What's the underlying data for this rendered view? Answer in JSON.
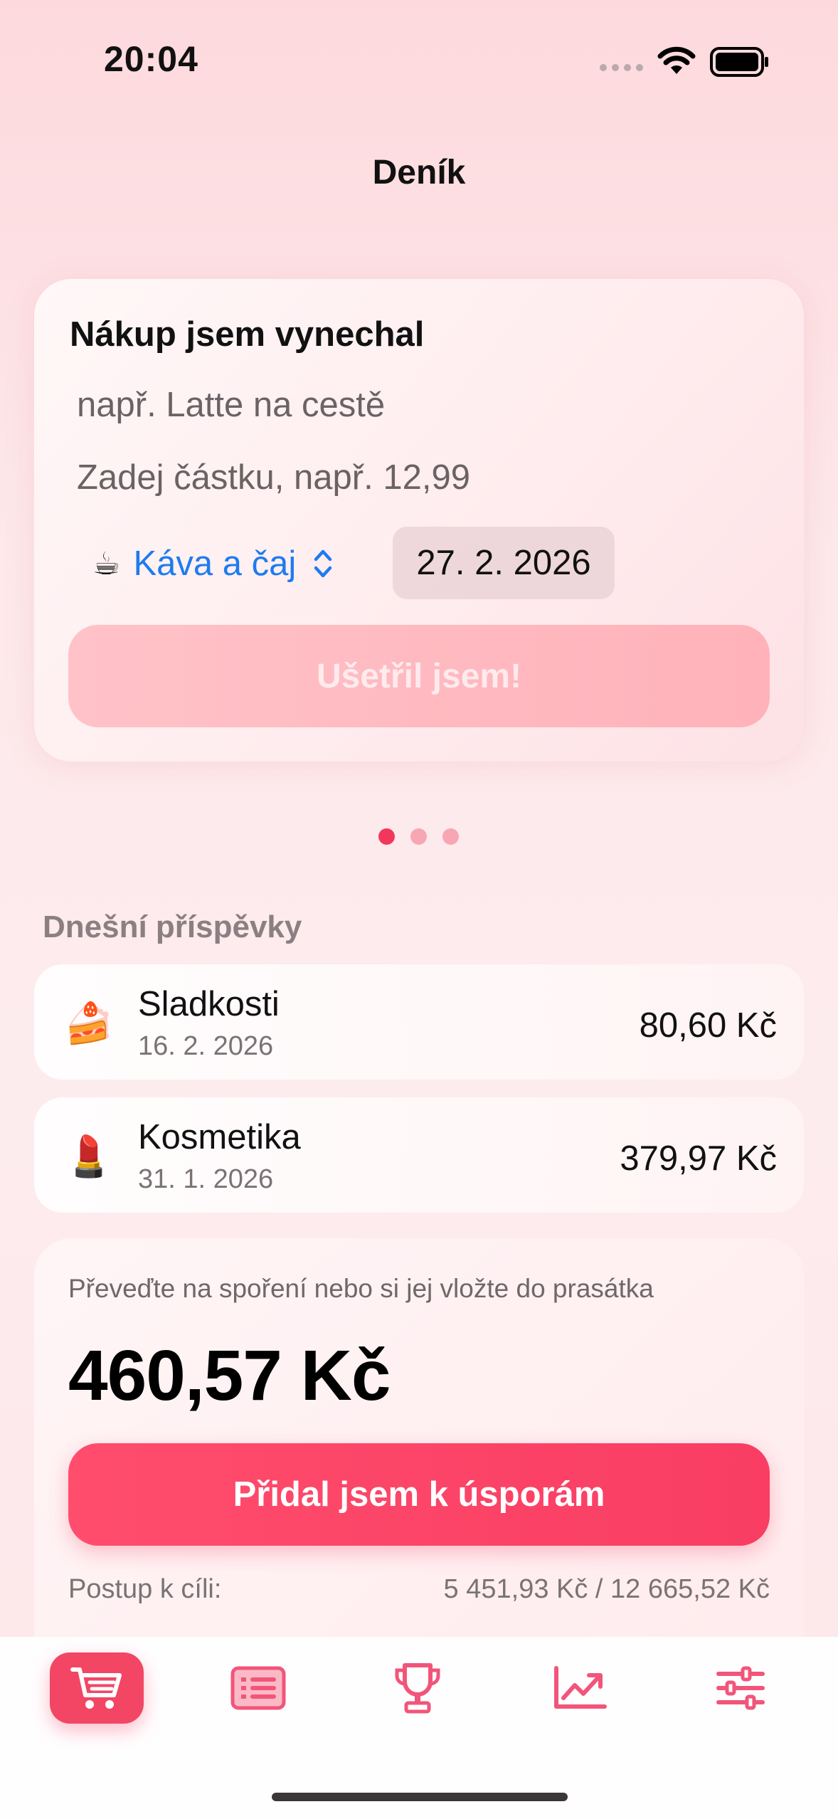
{
  "status_bar": {
    "time": "20:04"
  },
  "nav": {
    "title": "Deník"
  },
  "entry_form": {
    "title": "Nákup jsem vynechal",
    "name_placeholder": "např. Latte na cestě",
    "amount_placeholder": "Zadej částku, např. 12,99",
    "category": {
      "emoji": "☕",
      "label": "Káva a čaj"
    },
    "date": "27. 2. 2026",
    "submit_label": "Ušetřil jsem!"
  },
  "pager": {
    "count": 3,
    "active_index": 0
  },
  "today": {
    "heading": "Dnešní příspěvky",
    "items": [
      {
        "emoji": "🍰",
        "name": "Sladkosti",
        "date": "16. 2. 2026",
        "amount": "80,60 Kč"
      },
      {
        "emoji": "💄",
        "name": "Kosmetika",
        "date": "31. 1. 2026",
        "amount": "379,97 Kč"
      }
    ]
  },
  "savings": {
    "hint": "Převeďte na spoření nebo si jej vložte do prasátka",
    "total": "460,57 Kč",
    "button_label": "Přidal jsem k úsporám",
    "progress_label": "Postup k cíli:",
    "progress_value": "5 451,93 Kč / 12 665,52 Kč"
  },
  "tabs": [
    {
      "icon": "cart-icon",
      "active": true
    },
    {
      "icon": "list-icon",
      "active": false
    },
    {
      "icon": "trophy-icon",
      "active": false
    },
    {
      "icon": "chart-up-icon",
      "active": false
    },
    {
      "icon": "sliders-icon",
      "active": false
    }
  ],
  "colors": {
    "accent": "#F24664",
    "link": "#1E7BF0",
    "inactive_icon": "#F2557A"
  }
}
